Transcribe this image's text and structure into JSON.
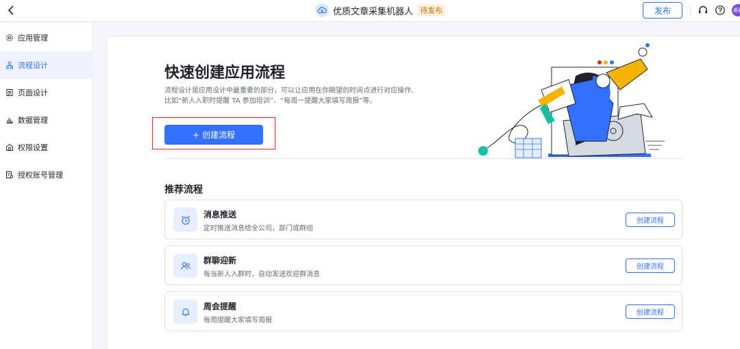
{
  "header": {
    "app_title": "优质文章采集机器人",
    "status": "待发布",
    "publish_label": "发布",
    "avatar_text": "桌面",
    "icons": [
      "back-arrow-icon",
      "cloud-icon",
      "headset-icon",
      "help-icon"
    ]
  },
  "sidebar": {
    "items": [
      {
        "label": "应用管理",
        "icon": "gear-icon",
        "active": false
      },
      {
        "label": "流程设计",
        "icon": "flow-icon",
        "active": true
      },
      {
        "label": "页面设计",
        "icon": "page-icon",
        "active": false
      },
      {
        "label": "数据管理",
        "icon": "chart-icon",
        "active": false
      },
      {
        "label": "权限设置",
        "icon": "lock-icon",
        "active": false
      },
      {
        "label": "授权账号管理",
        "icon": "account-icon",
        "active": false
      }
    ]
  },
  "hero": {
    "title": "快速创建应用流程",
    "description_line1": "流程设计是应用设计中最重要的部分，可以让应用在你期望的时间点进行对应操作,",
    "description_line2": "比如“新人入职时提醒 TA 参加培训”、“每周一提醒大家填写周报”等。",
    "create_button": "创建流程",
    "create_button_prefix": "+"
  },
  "recommend": {
    "title": "推荐流程",
    "items": [
      {
        "name": "消息推送",
        "desc": "定时推送消息给全公司，部门或群组",
        "button": "创建流程",
        "icon": "alarm-clock-icon"
      },
      {
        "name": "群聊迎新",
        "desc": "每当新人入群时，自动发送欢迎群消息",
        "button": "创建流程",
        "icon": "group-users-icon"
      },
      {
        "name": "周会提醒",
        "desc": "每周提醒大家填写周报",
        "button": "创建流程",
        "icon": "bell-icon"
      }
    ]
  },
  "colors": {
    "accent": "#3370ff",
    "highlight_border": "#e1251b",
    "status_tag_text": "#d46b08",
    "avatar_bg": "#7b4fd6"
  }
}
